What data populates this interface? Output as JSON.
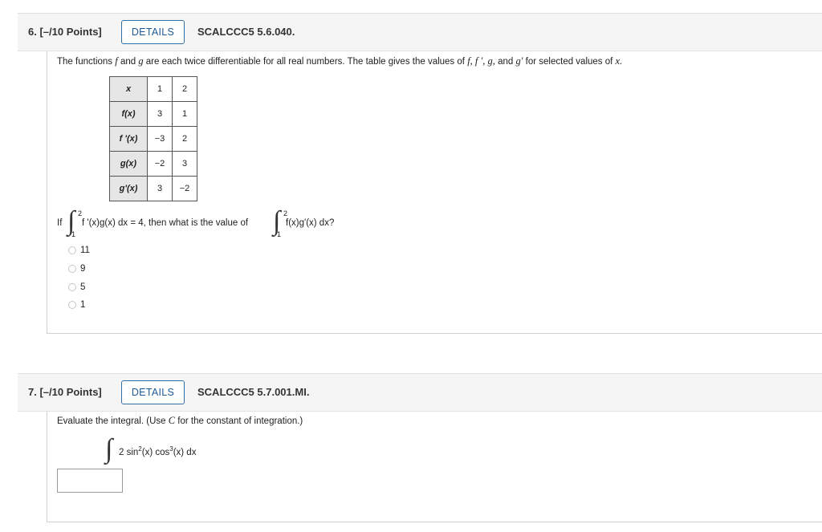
{
  "q6": {
    "number": "6. [–/10 Points]",
    "details": "DETAILS",
    "code": "SCALCCC5 5.6.040.",
    "prompt_a": "The functions",
    "prompt_f": "f",
    "prompt_b": "and",
    "prompt_g": "g",
    "prompt_c": "are each twice differentiable for all real numbers. The table gives the values of",
    "prompt_vars": "f, f ′, g,",
    "prompt_d": "and",
    "prompt_gp": "g′",
    "prompt_e": "for selected values of",
    "prompt_x": "x.",
    "table": {
      "header": [
        "x",
        "1",
        "2"
      ],
      "rows": [
        [
          "f(x)",
          "3",
          "1"
        ],
        [
          "f '(x)",
          "−3",
          "2"
        ],
        [
          "g(x)",
          "−2",
          "3"
        ],
        [
          "g'(x)",
          "3",
          "−2"
        ]
      ]
    },
    "if_label": "If",
    "upper1": "2",
    "lower1": "1",
    "integrand1": "f '(x)g(x) dx = 4, then what is the value of",
    "upper2": "2",
    "lower2": "1",
    "integrand2": "f(x)g'(x) dx?",
    "choices": [
      "11",
      "9",
      "5",
      "1"
    ]
  },
  "q7": {
    "number": "7. [–/10 Points]",
    "details": "DETAILS",
    "code": "SCALCCC5 5.7.001.MI.",
    "prompt_a": "Evaluate the integral. (Use",
    "prompt_c": "C",
    "prompt_b": "for the constant of integration.)",
    "integrand_coef": "2 sin",
    "exp1": "2",
    "integrand_mid": "(x) cos",
    "exp2": "3",
    "integrand_end": "(x) dx",
    "answer_value": ""
  }
}
